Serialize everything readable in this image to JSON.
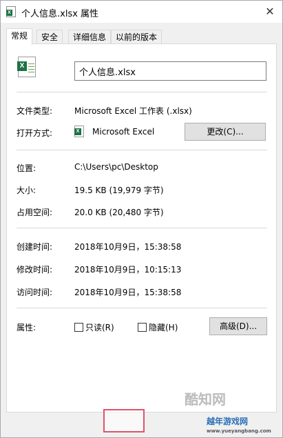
{
  "window": {
    "title": "个人信息.xlsx 属性",
    "close_glyph": "✕"
  },
  "tabs": [
    {
      "label": "常规"
    },
    {
      "label": "安全"
    },
    {
      "label": "详细信息"
    },
    {
      "label": "以前的版本"
    }
  ],
  "general": {
    "file_name": "个人信息.xlsx",
    "file_type_label": "文件类型:",
    "file_type_value": "Microsoft Excel 工作表 (.xlsx)",
    "open_with_label": "打开方式:",
    "open_with_value": "Microsoft Excel",
    "change_button": "更改(C)...",
    "location_label": "位置:",
    "location_value": "C:\\Users\\pc\\Desktop",
    "size_label": "大小:",
    "size_value": "19.5 KB (19,979 字节)",
    "size_on_disk_label": "占用空间:",
    "size_on_disk_value": "20.0 KB (20,480 字节)",
    "created_label": "创建时间:",
    "created_value": "2018年10月9日，15:38:58",
    "modified_label": "修改时间:",
    "modified_value": "2018年10月9日，10:15:13",
    "accessed_label": "访问时间:",
    "accessed_value": "2018年10月9日，15:38:58",
    "attributes_label": "属性:",
    "readonly_label": "只读(R)",
    "hidden_label": "隐藏(H)",
    "advanced_button": "高级(D)..."
  },
  "watermark": {
    "brand": "酷知网",
    "site": "越年游戏网",
    "url": "www.yueyangbang.com"
  },
  "icons": {
    "file": "excel-file-icon",
    "app": "excel-app-icon"
  },
  "colors": {
    "excel_green": "#1e7145",
    "highlight": "#e0516a"
  }
}
